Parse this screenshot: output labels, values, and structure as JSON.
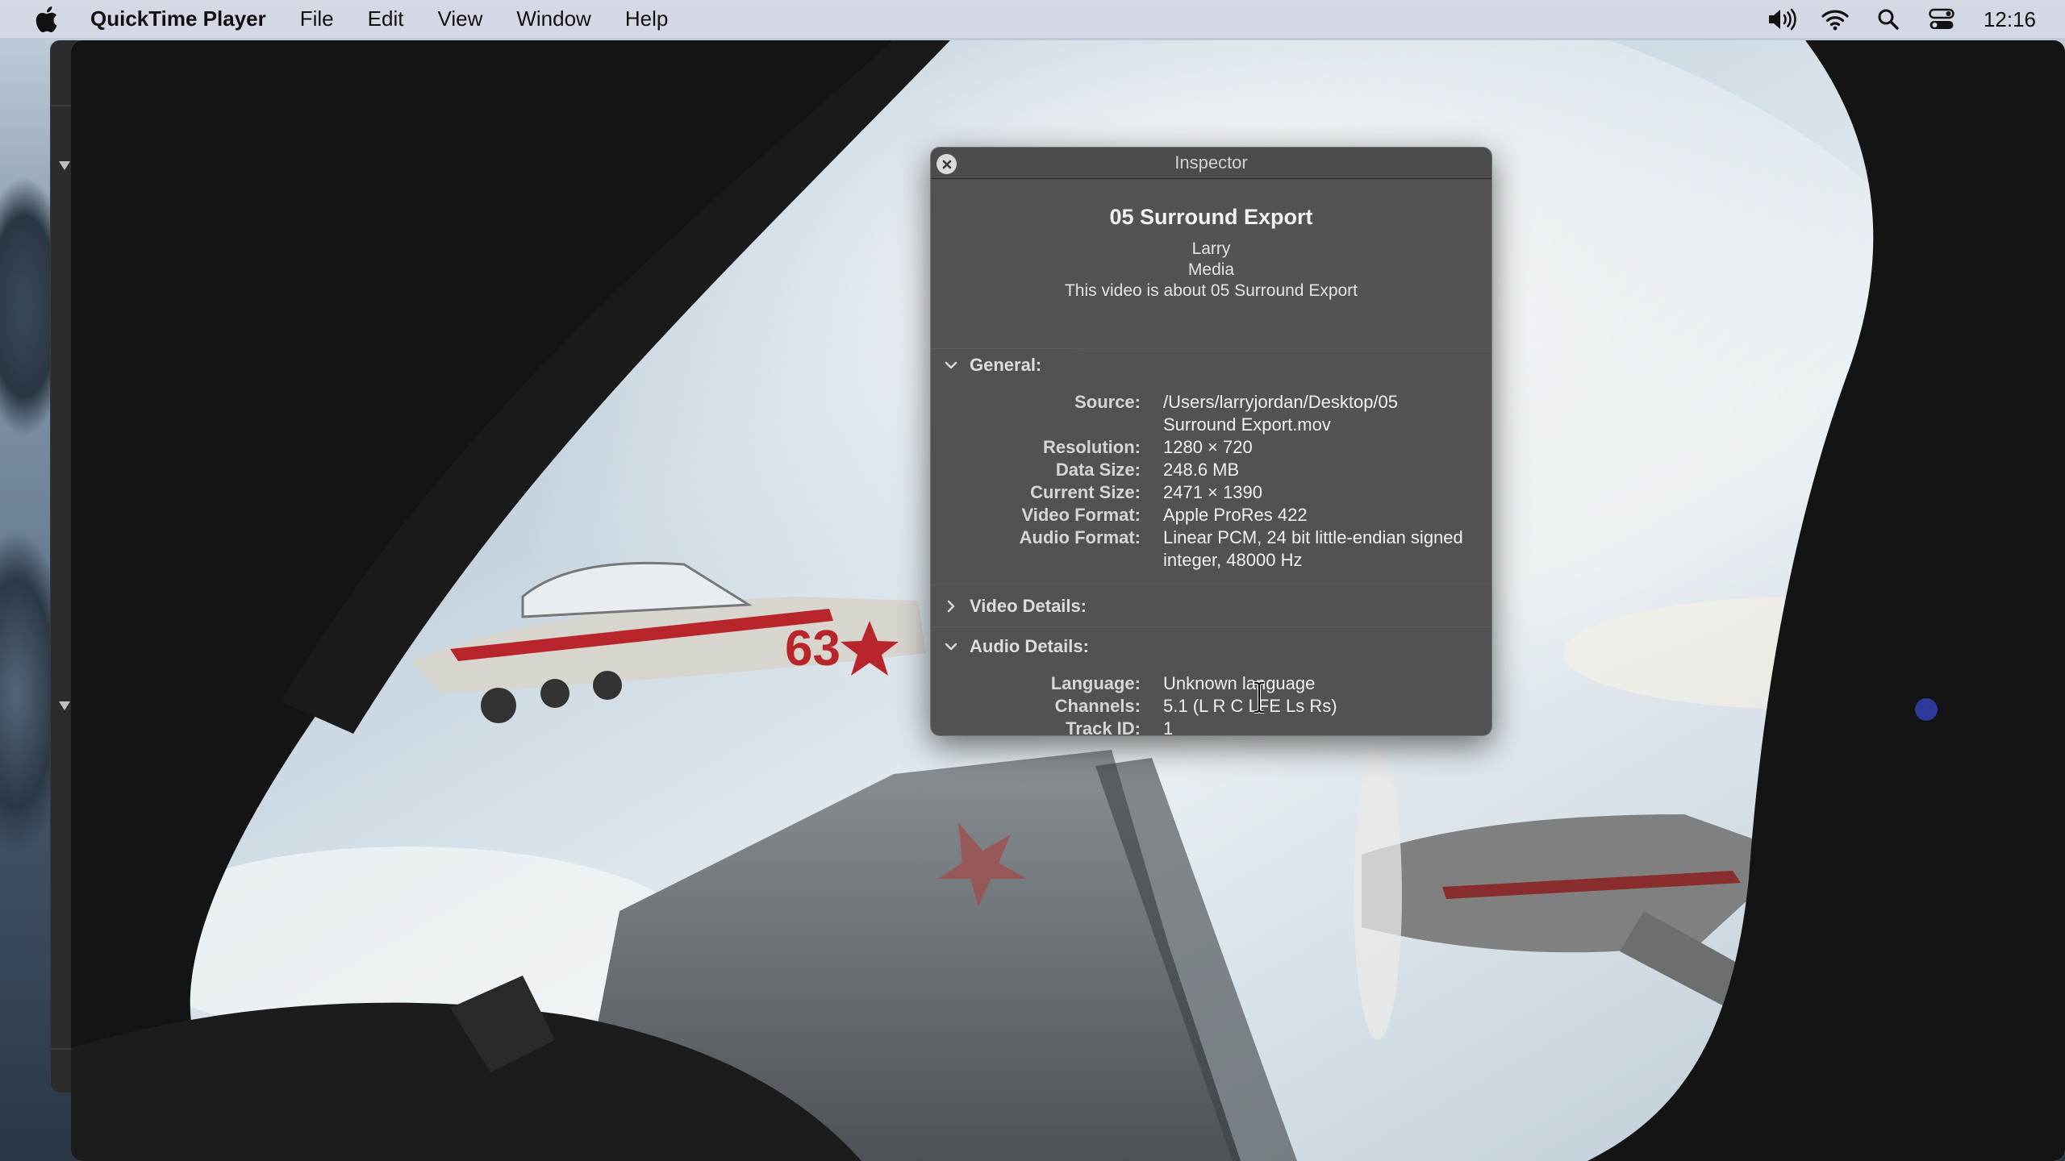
{
  "menubar": {
    "app_name": "QuickTime Player",
    "menus": [
      "File",
      "Edit",
      "View",
      "Window",
      "Help"
    ],
    "status_icons": [
      "volume-icon",
      "wifi-icon",
      "spotlight-search-icon",
      "control-center-icon"
    ],
    "clock": "12:16"
  },
  "inspector": {
    "window_title": "Inspector",
    "file_title": "05 Surround Export",
    "author": "Larry",
    "genre": "Media",
    "description": "This video is about 05 Surround Export",
    "general": {
      "header": "General:",
      "expanded": true,
      "source_label": "Source:",
      "source_value": "/Users/larryjordan/Desktop/05 Surround Export.mov",
      "resolution_label": "Resolution:",
      "resolution_value": "1280 × 720",
      "data_size_label": "Data Size:",
      "data_size_value": "248.6 MB",
      "current_size_label": "Current Size:",
      "current_size_value": "2471 × 1390",
      "video_format_label": "Video Format:",
      "video_format_value": "Apple ProRes 422",
      "audio_format_label": "Audio Format:",
      "audio_format_value": "Linear PCM, 24 bit little-endian signed integer, 48000 Hz"
    },
    "video_details": {
      "header": "Video Details:",
      "expanded": false
    },
    "audio_details": {
      "header": "Audio Details:",
      "expanded": true,
      "language_label": "Language:",
      "language_value": "Unknown language",
      "channels_label": "Channels:",
      "channels_value": "5.1 (L R C LFE Ls Rs)",
      "track_id_label": "Track ID:",
      "track_id_value": "1"
    }
  },
  "player": {
    "plane_marking": "63"
  },
  "colors": {
    "menubar_bg": "#d4d8e4",
    "inspector_bg": "#464648",
    "plane_red": "#b8262c"
  }
}
